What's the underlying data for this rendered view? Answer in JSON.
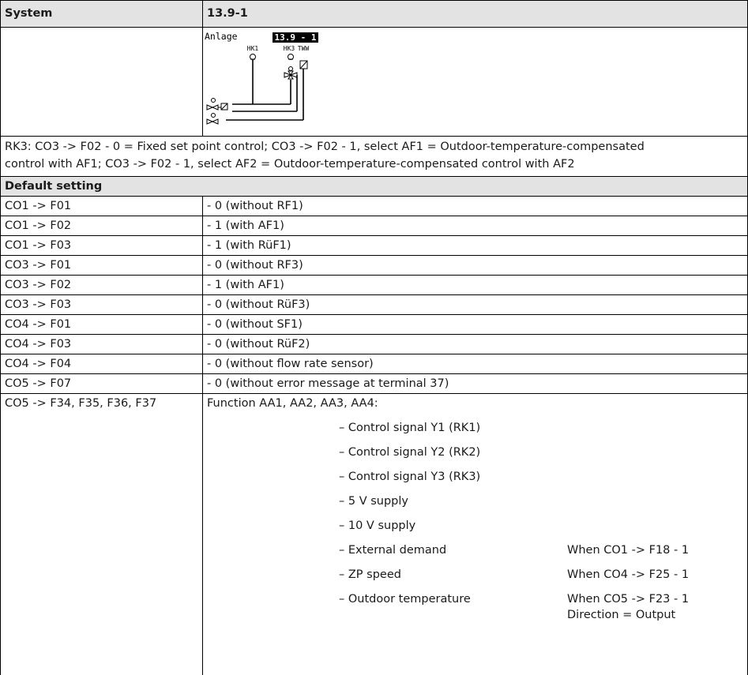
{
  "header": {
    "col1": "System",
    "col2": "13.9-1"
  },
  "diagram": {
    "anlage_label": "Anlage",
    "code": "13.9 - 1",
    "hk1": "HK1",
    "hk3": "HK3",
    "tww": "TWW"
  },
  "description": {
    "line1": "RK3: CO3 -> F02 - 0 = Fixed set point control; CO3 -> F02 - 1, select AF1 = Outdoor-temperature-compensated",
    "line2": "control with AF1; CO3 -> F02 - 1, select AF2 = Outdoor-temperature-compensated control with AF2"
  },
  "default_heading": "Default setting",
  "settings": [
    {
      "code": "CO1 -> F01",
      "value": "- 0 (without RF1)"
    },
    {
      "code": "CO1 -> F02",
      "value": "- 1 (with AF1)"
    },
    {
      "code": "CO1 -> F03",
      "value": "- 1 (with RüF1)"
    },
    {
      "code": "CO3 -> F01",
      "value": "- 0 (without RF3)"
    },
    {
      "code": "CO3 -> F02",
      "value": "- 1 (with AF1)"
    },
    {
      "code": "CO3 -> F03",
      "value": "- 0 (without RüF3)"
    },
    {
      "code": "CO4 -> F01",
      "value": "- 0 (without SF1)"
    },
    {
      "code": "CO4 -> F03",
      "value": "- 0 (without RüF2)"
    },
    {
      "code": "CO4 -> F04",
      "value": "- 0 (without flow rate sensor)"
    },
    {
      "code": "CO5 -> F07",
      "value": "- 0 (without error message at terminal 37)"
    }
  ],
  "functions": {
    "code": "CO5 -> F34, F35, F36, F37",
    "title": "Function AA1, AA2, AA3, AA4:",
    "items": [
      {
        "label": "– Control signal Y1 (RK1)",
        "cond": ""
      },
      {
        "label": "– Control signal Y2 (RK2)",
        "cond": ""
      },
      {
        "label": "– Control signal Y3 (RK3)",
        "cond": ""
      },
      {
        "label": "– 5 V supply",
        "cond": ""
      },
      {
        "label": "– 10 V supply",
        "cond": ""
      },
      {
        "label": "– External demand",
        "cond": "When CO1 -> F18 - 1"
      },
      {
        "label": "– ZP speed",
        "cond": "When CO4 -> F25 - 1"
      },
      {
        "label": "– Outdoor temperature",
        "cond": "When CO5 -> F23 - 1"
      }
    ],
    "extra_cond": "Direction = Output"
  }
}
